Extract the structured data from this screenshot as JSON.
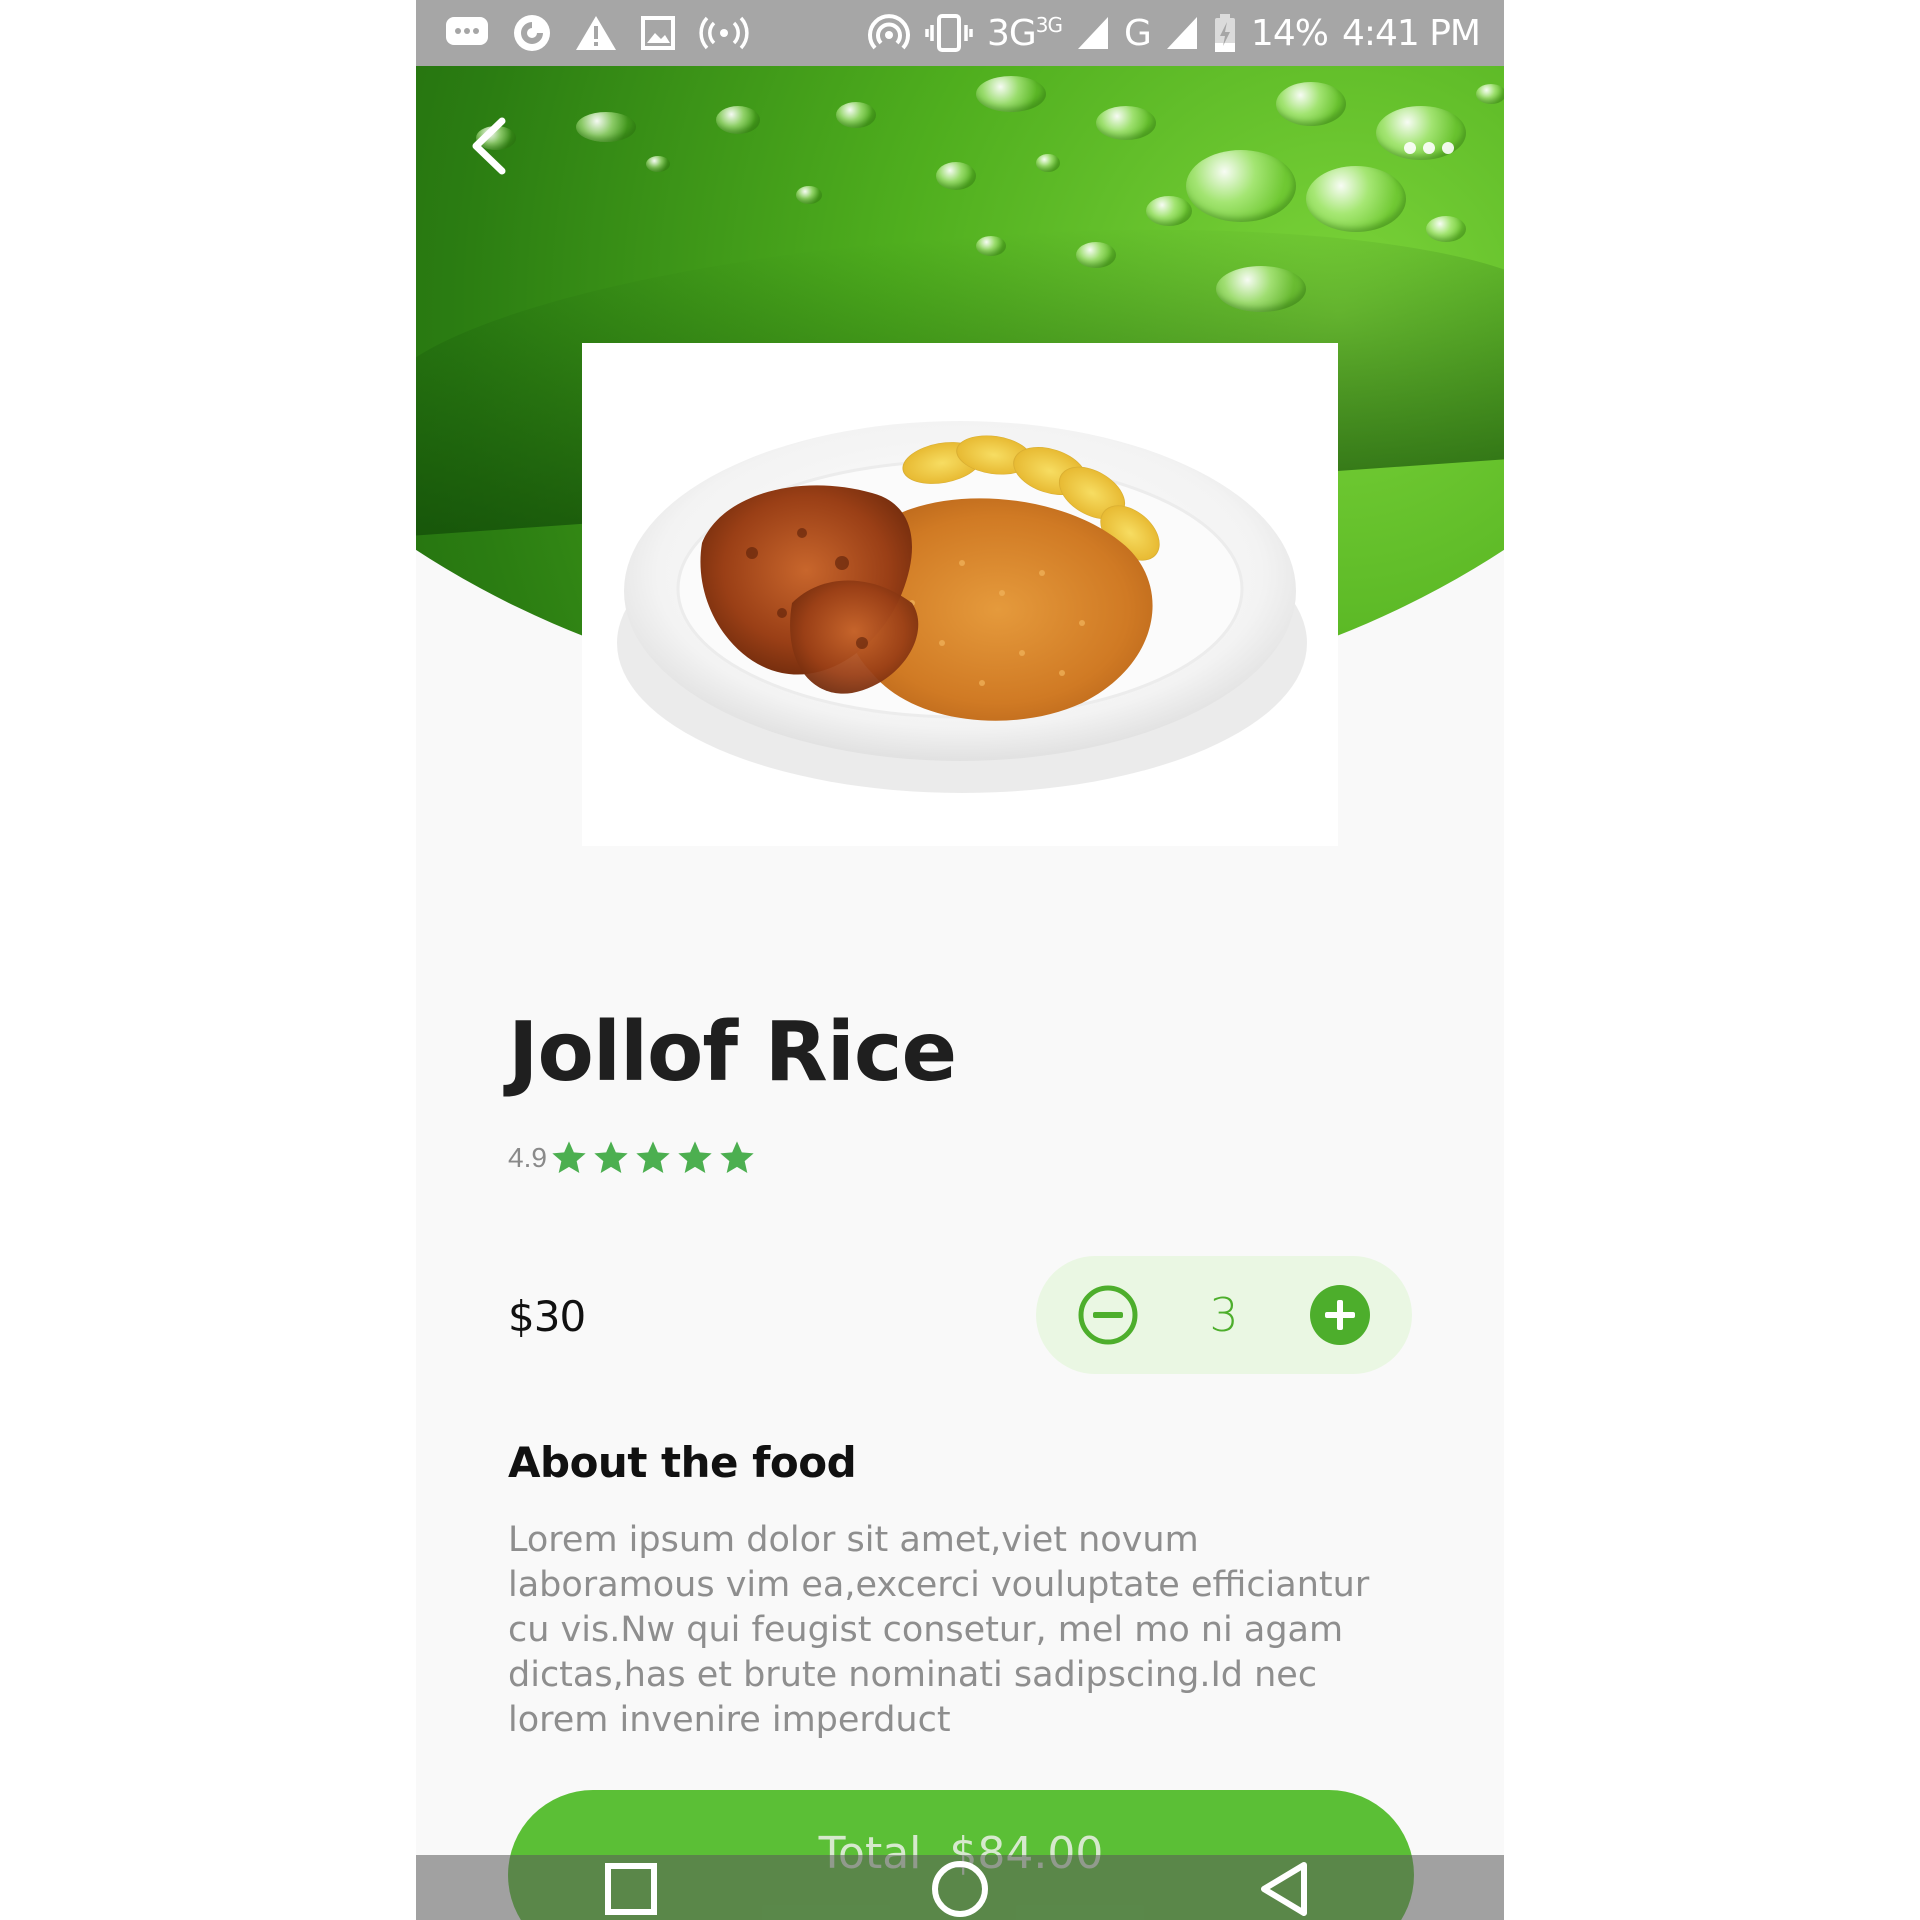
{
  "status_bar": {
    "network_3g": "3G",
    "network_3g_sup": "3G",
    "network_g": "G",
    "battery": "14%",
    "time": "4:41 PM"
  },
  "food": {
    "name": "Jollof Rice",
    "rating": "4.9",
    "stars": 5,
    "price": "$30",
    "quantity": "3"
  },
  "about": {
    "title": "About the food",
    "description": "Lorem ipsum dolor sit amet,viet novum laboramous vim ea,excerci vouluptate efficiantur cu vis.Nw qui feugist consetur, mel mo ni agam dictas,has et brute nominati sadipscing.Id nec lorem invenire imperduct"
  },
  "cta": {
    "label": "Total  $84.00"
  },
  "colors": {
    "accent": "#5bbf36",
    "accent_dark": "#4dae2c",
    "qty_bg": "#eaf7e3",
    "star": "#4caf50"
  },
  "icons": {
    "back": "chevron-left-icon",
    "more": "more-horizontal-icon",
    "decrease": "minus-circle-icon",
    "increase": "plus-circle-icon",
    "nav_recents": "square-icon",
    "nav_home": "circle-icon",
    "nav_back": "triangle-back-icon"
  }
}
